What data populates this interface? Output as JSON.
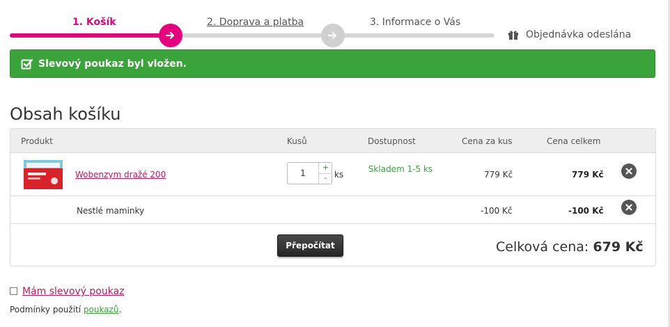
{
  "steps": {
    "step1": "1. Košík",
    "step2": "2. Doprava a platba",
    "step3": "3. Informace o Vás",
    "step4": "Objednávka odeslána"
  },
  "alert": {
    "text": "Slevový poukaz byl vložen.",
    "color": "#3aa33a"
  },
  "cart": {
    "title": "Obsah košíku",
    "headers": {
      "product": "Produkt",
      "qty": "Kusů",
      "availability": "Dostupnost",
      "unit_price": "Cena za kus",
      "total_price": "Cena celkem"
    },
    "rows": [
      {
        "name": "Wobenzym dražé 200",
        "qty": "1",
        "unit": "ks",
        "availability": "Skladem 1-5 ks",
        "unit_price": "779 Kč",
        "total": "779 Kč",
        "image": "product-box-image"
      },
      {
        "name": "Nestlé maminky",
        "unit_price": "-100 Kč",
        "total": "-100 Kč"
      }
    ],
    "qty_plus": "+",
    "qty_minus": "–",
    "recalc_label": "Přepočítat",
    "total_label": "Celková cena:",
    "total_value": "679 Kč"
  },
  "voucher": {
    "checkbox_label": "Mám slevový poukaz",
    "terms_prefix": "Podmínky použití ",
    "terms_link": "poukazů",
    "terms_suffix": "."
  },
  "colors": {
    "accent": "#e6007e",
    "success": "#3aa33a",
    "link": "#c2185b"
  }
}
